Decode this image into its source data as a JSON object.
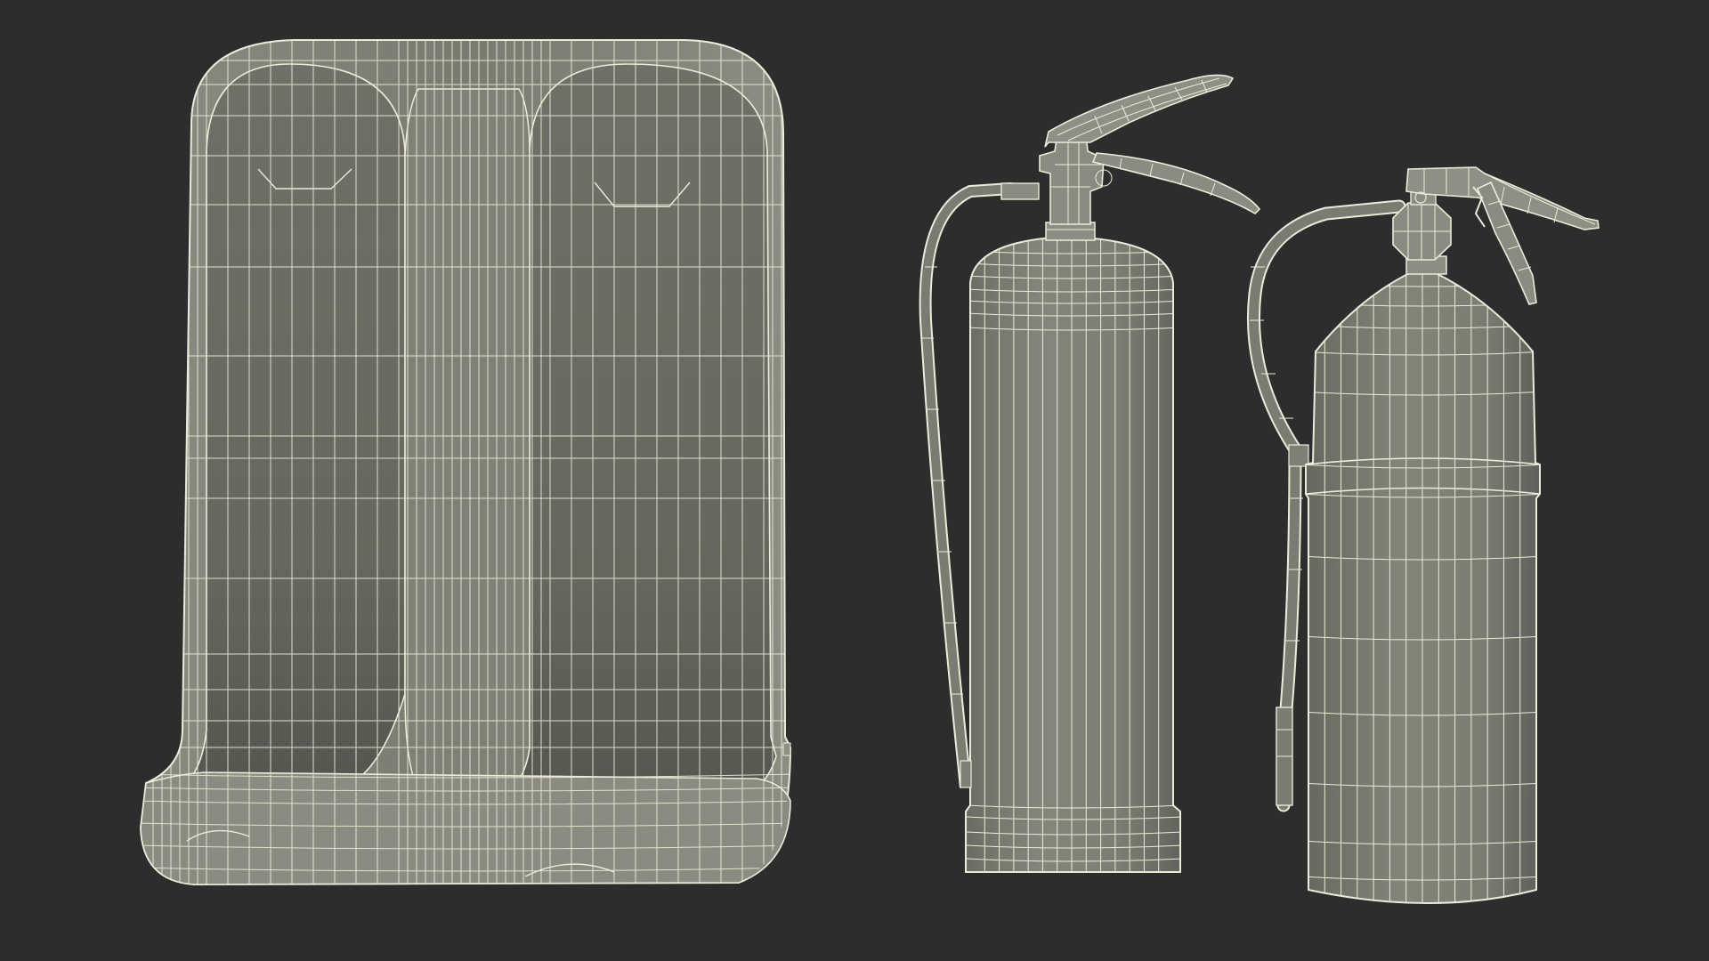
{
  "scene": {
    "background": "#2d2d2d",
    "surface_color": "#7d7e73",
    "surface_dark": "#5c5d55",
    "surface_light": "#8f9085",
    "wire_color": "#ecebd9",
    "objects": [
      {
        "kind": "extinguisher-stand",
        "style": "wireframe"
      },
      {
        "kind": "fire-extinguisher",
        "style": "wireframe"
      },
      {
        "kind": "fire-extinguisher",
        "style": "wireframe"
      }
    ]
  }
}
